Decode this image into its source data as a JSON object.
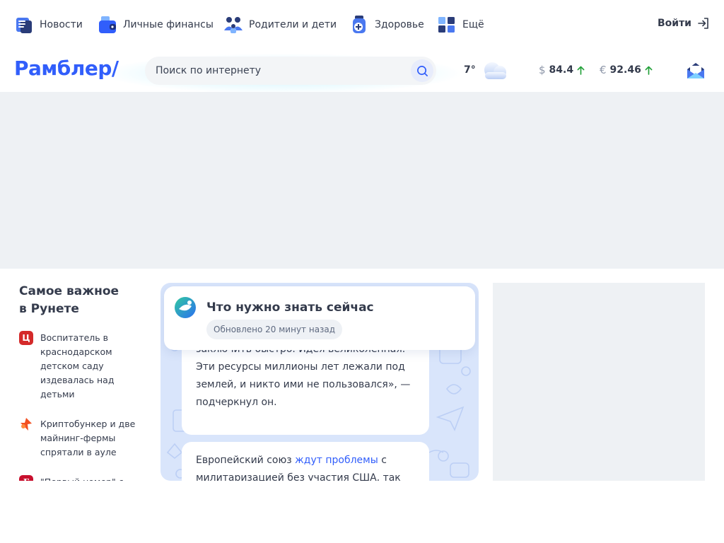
{
  "nav": {
    "items": [
      {
        "label": "Новости",
        "icon": "newspaper-icon"
      },
      {
        "label": "Личные финансы",
        "icon": "wallet-icon"
      },
      {
        "label": "Родители и дети",
        "icon": "family-icon"
      },
      {
        "label": "Здоровье",
        "icon": "medicine-icon"
      },
      {
        "label": "Ещё",
        "icon": "grid-icon"
      }
    ],
    "login_label": "Войти"
  },
  "header": {
    "logo": "Рамблер/",
    "search_placeholder": "Поиск по интернету",
    "weather_temp": "7°",
    "weather_icon": "cloud-icon",
    "rates": [
      {
        "symbol": "$",
        "value": "84.4",
        "trend": "up"
      },
      {
        "symbol": "€",
        "value": "92.46",
        "trend": "up"
      }
    ],
    "mail_icon": "mail-icon"
  },
  "left": {
    "title_line1": "Самое важное",
    "title_line2": "в Рунете",
    "items": [
      {
        "source_letter": "Ц",
        "source_color": "#d42a2a",
        "text": "Воспитатель в краснодарском детском саду издевалась над детьми"
      },
      {
        "source_letter": "",
        "source_color": "#f25022",
        "text": "Криптобункер и две майнинг-фермы спрятали в ауле"
      },
      {
        "source_letter": "Г",
        "source_color": "#c8102e",
        "text": "\"Первый номер\" с Цыгановым получил"
      }
    ]
  },
  "middle": {
    "card_title": "Что нужно знать сейчас",
    "card_updated": "Обновлено 20 минут назад",
    "msg1_text": "заключить быстро. Идея великолепная. Эти ресурсы миллионы лет лежали под землей, и никто ими не пользовался», — подчеркнул он.",
    "msg2_before": "Европейский союз ",
    "msg2_link": "ждут проблемы",
    "msg2_after": " с милитаризацией без участия США, так как"
  },
  "colors": {
    "accent": "#315efb",
    "text": "#343b4c",
    "trend_up": "#21a038"
  }
}
